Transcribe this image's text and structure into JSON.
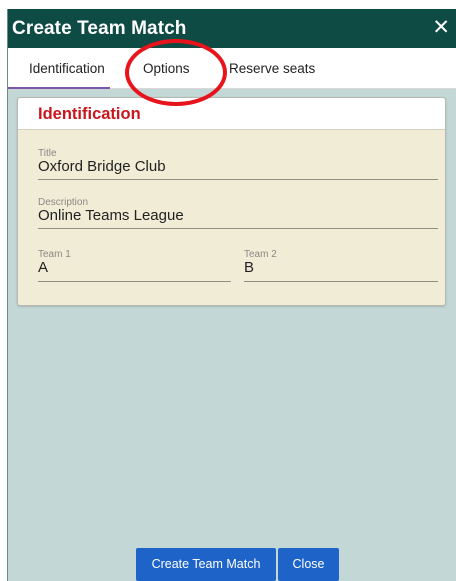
{
  "dialog": {
    "title": "Create Team Match",
    "close_glyph": "✕"
  },
  "tabs": [
    {
      "label": "Identification"
    },
    {
      "label": "Options"
    },
    {
      "label": "Reserve seats"
    }
  ],
  "card": {
    "header": "Identification",
    "fields": {
      "title": {
        "label": "Title",
        "value": "Oxford Bridge Club"
      },
      "description": {
        "label": "Description",
        "value": "Online Teams League"
      },
      "team1": {
        "label": "Team 1",
        "value": "A"
      },
      "team2": {
        "label": "Team 2",
        "value": "B"
      }
    }
  },
  "buttons": {
    "create": "Create Team Match",
    "close": "Close"
  },
  "colors": {
    "titlebar": "#0e4b44",
    "card_header_text": "#c8161d",
    "button": "#1e64c8",
    "annotation": "#e8141c"
  },
  "icons": {
    "close": "close-icon"
  }
}
